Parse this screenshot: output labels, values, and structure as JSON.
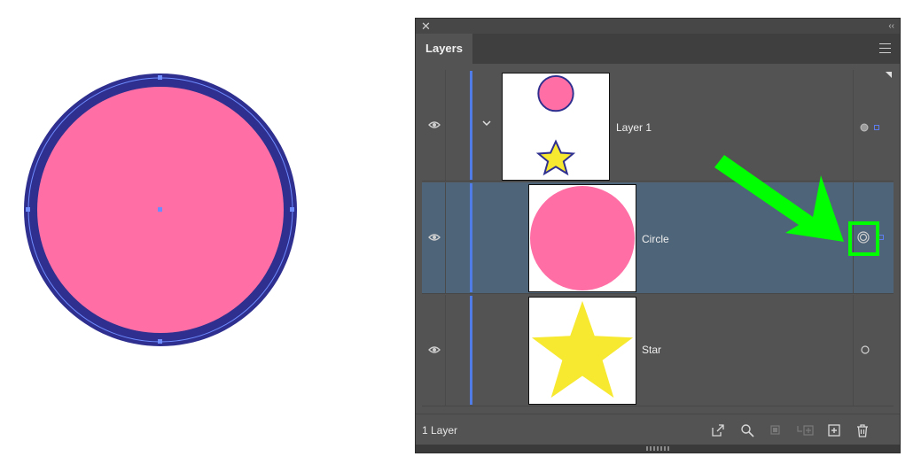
{
  "panel": {
    "tab_label": "Layers",
    "close_glyph": "✕",
    "collapse_glyph": "‹‹",
    "footer_label": "1 Layer"
  },
  "layers": [
    {
      "name": "Layer 1",
      "thumbnail": "circle-and-star",
      "selected": false
    },
    {
      "name": "Circle",
      "thumbnail": "circle",
      "selected": true
    },
    {
      "name": "Star",
      "thumbnail": "star",
      "selected": false
    }
  ],
  "footer_buttons": [
    "export-icon",
    "locate-icon",
    "clip-mask-icon",
    "new-sublayer-icon",
    "new-layer-icon",
    "trash-icon"
  ],
  "colors": {
    "circle_fill": "#ff6fa5",
    "circle_stroke": "#2e2f8f",
    "star_fill": "#f7e830",
    "selection_blue": "#4f7ce6",
    "row_selected": "#4e6478",
    "annotation_green": "#00ff00"
  }
}
